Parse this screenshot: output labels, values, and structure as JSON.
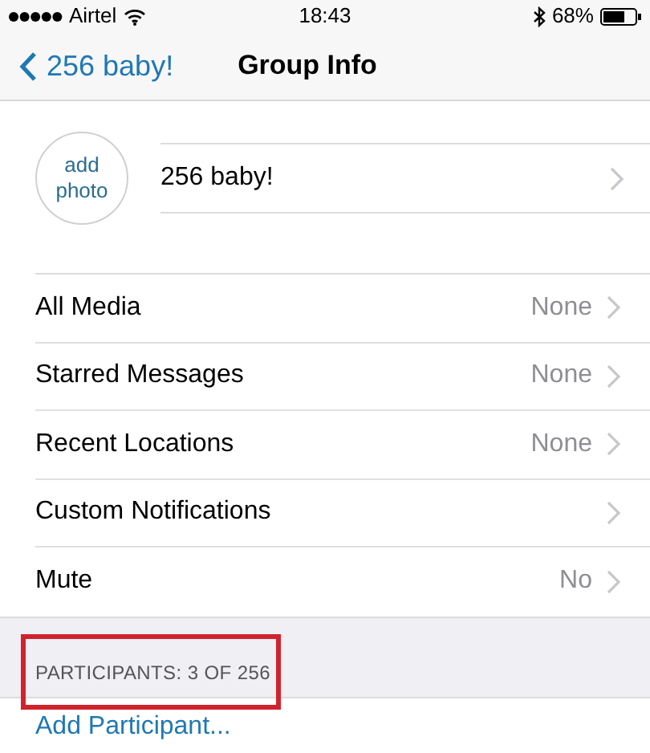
{
  "status_bar": {
    "carrier": "Airtel",
    "time": "18:43",
    "battery": "68%"
  },
  "nav": {
    "back": "256 baby!",
    "title": "Group Info"
  },
  "group": {
    "photo_label": "add photo",
    "name": "256 baby!"
  },
  "rows": [
    {
      "label": "All Media",
      "value": "None"
    },
    {
      "label": "Starred Messages",
      "value": "None"
    },
    {
      "label": "Recent Locations",
      "value": "None"
    },
    {
      "label": "Custom Notifications"
    },
    {
      "label": "Mute",
      "value": "No"
    }
  ],
  "participants": {
    "header": "PARTICIPANTS: 3 OF 256",
    "highlighted": true,
    "add": "Add Participant..."
  }
}
